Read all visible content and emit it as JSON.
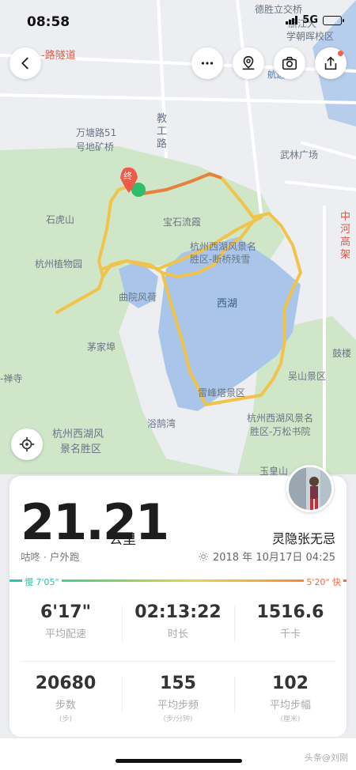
{
  "status_bar": {
    "time": "08:58",
    "network": "5G"
  },
  "map": {
    "labels": {
      "a": "德胜立交桥",
      "b": "浙江大",
      "c": "学朝晖校区",
      "d": "-路隧道",
      "e": "万塘路51",
      "f": "号地矿桥",
      "g": "教",
      "h": "工",
      "i": "路",
      "j": "武林广场",
      "k": "石虎山",
      "l": "宝石流霞",
      "m": "杭州西湖风景名",
      "n": "胜区-断桥残雪",
      "o": "杭州植物园",
      "p": "曲院风荷",
      "q": "西湖",
      "r": "茅家埠",
      "s": "吴山景区",
      "t": "鼓楼",
      "u": "-禅寺",
      "v": "雷峰塔景区",
      "w": "杭州西湖风景名",
      "x": "胜区-万松书院",
      "y": "杭州西湖风",
      "z": "景名胜区",
      "aa": "浴鹄湾",
      "ab": "玉皇山",
      "ac": "中",
      "ad": "河",
      "ae": "高",
      "af": "架",
      "ag": "中河",
      "ah": "航运河",
      "ai": "终"
    }
  },
  "toolbar": {
    "back_icon": "back-icon",
    "more_icon": "more-icon",
    "location_icon": "map-pin-icon",
    "camera_icon": "camera-icon",
    "share_icon": "share-icon"
  },
  "summary": {
    "distance": "21.21",
    "unit": "公里",
    "sport": "咕咚 · 户外跑",
    "username": "灵隐张无忌",
    "datetime": "2018 年 10月17日 04:25"
  },
  "pace_scale": {
    "slow": "慢 7'05\"",
    "fast": "5'20\" 快"
  },
  "stats": [
    {
      "value": "6'17\"",
      "label": "平均配速",
      "sub": ""
    },
    {
      "value": "02:13:22",
      "label": "时长",
      "sub": ""
    },
    {
      "value": "1516.6",
      "label": "千卡",
      "sub": ""
    },
    {
      "value": "20680",
      "label": "步数",
      "sub": "(步)"
    },
    {
      "value": "155",
      "label": "平均步频",
      "sub": "(步/分钟)"
    },
    {
      "value": "102",
      "label": "平均步幅",
      "sub": "(厘米)"
    }
  ],
  "watermark": "头条@刘刚",
  "colors": {
    "route": "#f0c34a",
    "route_end": "#e87a3a",
    "lake": "#aac8ea",
    "green": "#cde8c8"
  }
}
